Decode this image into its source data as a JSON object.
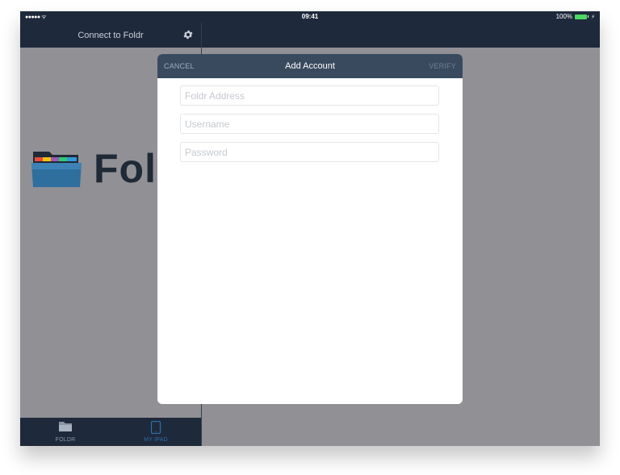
{
  "status_bar": {
    "signal": "●●●●● ᯤ",
    "time": "09:41",
    "battery": "100%"
  },
  "sidebar": {
    "title": "Connect to Foldr",
    "settings_icon": "gear-icon"
  },
  "logo": {
    "text": "Fol"
  },
  "tabbar": {
    "tabs": [
      {
        "label": "FOLDR",
        "icon": "folder-icon",
        "color": "#8a95a5"
      },
      {
        "label": "MY IPAD",
        "icon": "ipad-icon",
        "color": "#2f6ea8"
      }
    ]
  },
  "modal": {
    "cancel_label": "CANCEL",
    "title": "Add Account",
    "verify_label": "VERIFY",
    "fields": {
      "address": {
        "value": "",
        "placeholder": "Foldr Address"
      },
      "username": {
        "value": "",
        "placeholder": "Username"
      },
      "password": {
        "value": "",
        "placeholder": "Password"
      }
    }
  },
  "colors": {
    "navy": "#1e293b",
    "modal_header": "#394a5f",
    "overlay_gray": "#909095",
    "battery_green": "#4cd964",
    "active_tab": "#2f6ea8"
  }
}
